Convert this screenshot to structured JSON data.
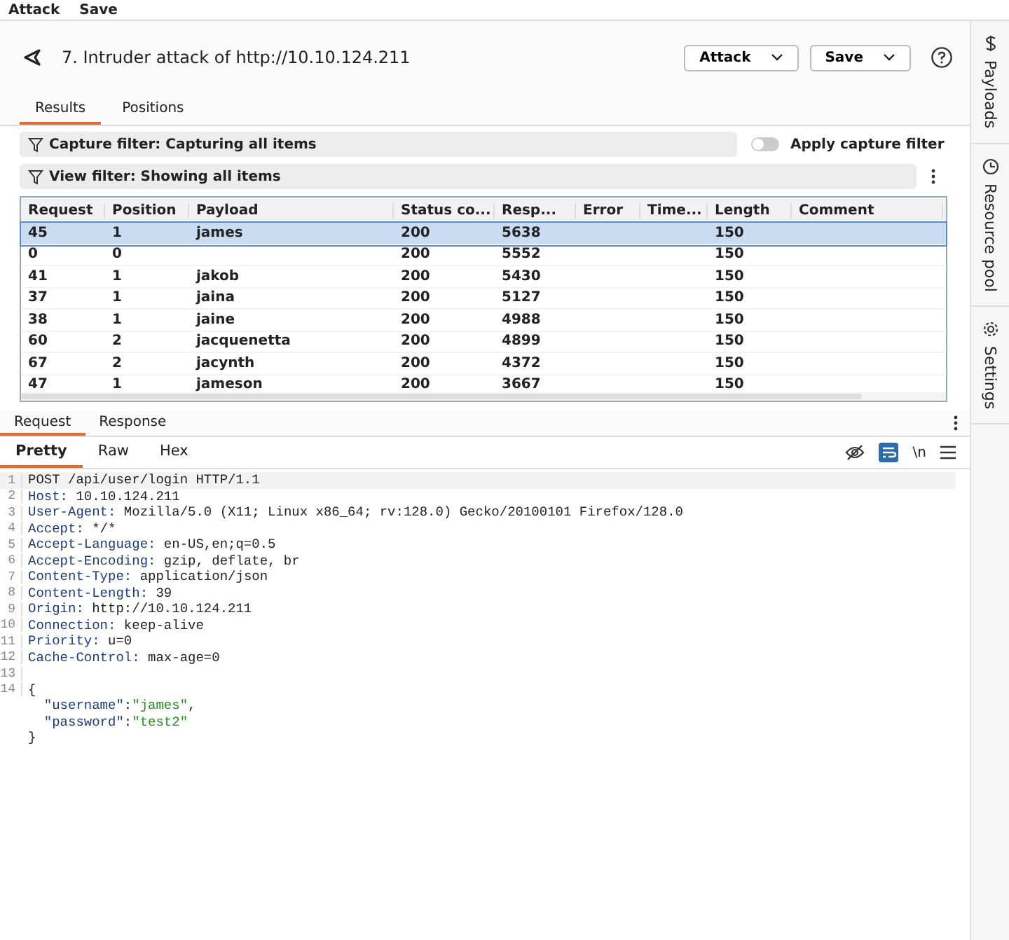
{
  "menu": [
    "Attack",
    "Save"
  ],
  "header": {
    "title": "7. Intruder attack of http://10.10.124.211",
    "buttons": [
      "Attack",
      "Save"
    ]
  },
  "tabs": [
    {
      "label": "Results",
      "selected": true
    },
    {
      "label": "Positions",
      "selected": false
    }
  ],
  "capture_filter": {
    "label": "Capture filter: Capturing all items",
    "toggle_label": "Apply capture filter",
    "on": false
  },
  "view_filter": {
    "label": "View filter: Showing all items"
  },
  "table": {
    "columns": [
      "Request",
      "Position",
      "Payload",
      "Status co...",
      "Resp...",
      "Error",
      "Time...",
      "Length",
      "Comment"
    ],
    "rows": [
      {
        "cells": [
          "45",
          "1",
          "james",
          "200",
          "5638",
          "",
          "",
          "150",
          ""
        ],
        "selected": true
      },
      {
        "cells": [
          "0",
          "0",
          "",
          "200",
          "5552",
          "",
          "",
          "150",
          ""
        ],
        "selected": false
      },
      {
        "cells": [
          "41",
          "1",
          "jakob",
          "200",
          "5430",
          "",
          "",
          "150",
          ""
        ],
        "selected": false
      },
      {
        "cells": [
          "37",
          "1",
          "jaina",
          "200",
          "5127",
          "",
          "",
          "150",
          ""
        ],
        "selected": false
      },
      {
        "cells": [
          "38",
          "1",
          "jaine",
          "200",
          "4988",
          "",
          "",
          "150",
          ""
        ],
        "selected": false
      },
      {
        "cells": [
          "60",
          "2",
          "jacquenetta",
          "200",
          "4899",
          "",
          "",
          "150",
          ""
        ],
        "selected": false
      },
      {
        "cells": [
          "67",
          "2",
          "jacynth",
          "200",
          "4372",
          "",
          "",
          "150",
          ""
        ],
        "selected": false
      },
      {
        "cells": [
          "47",
          "1",
          "jameson",
          "200",
          "3667",
          "",
          "",
          "150",
          ""
        ],
        "selected": false
      }
    ]
  },
  "message_tabs": [
    {
      "label": "Request",
      "selected": true
    },
    {
      "label": "Response",
      "selected": false
    }
  ],
  "view_tabs": [
    {
      "label": "Pretty",
      "selected": true
    },
    {
      "label": "Raw",
      "selected": false
    },
    {
      "label": "Hex",
      "selected": false
    }
  ],
  "newline_button": "\\n",
  "code": [
    {
      "number": "1",
      "parts": [
        {
          "kind": "plain",
          "text": "POST /api/user/login HTTP/1.1"
        }
      ]
    },
    {
      "number": "2",
      "parts": [
        {
          "kind": "key",
          "text": "Host: "
        },
        {
          "kind": "plain",
          "text": "10.10.124.211"
        }
      ]
    },
    {
      "number": "3",
      "parts": [
        {
          "kind": "key",
          "text": "User-Agent: "
        },
        {
          "kind": "plain",
          "text": "Mozilla/5.0 (X11; Linux x86_64; rv:128.0) Gecko/20100101 Firefox/128.0"
        }
      ]
    },
    {
      "number": "4",
      "parts": [
        {
          "kind": "key",
          "text": "Accept: "
        },
        {
          "kind": "plain",
          "text": "*/*"
        }
      ]
    },
    {
      "number": "5",
      "parts": [
        {
          "kind": "key",
          "text": "Accept-Language: "
        },
        {
          "kind": "plain",
          "text": "en-US,en;q=0.5"
        }
      ]
    },
    {
      "number": "6",
      "parts": [
        {
          "kind": "key",
          "text": "Accept-Encoding: "
        },
        {
          "kind": "plain",
          "text": "gzip, deflate, br"
        }
      ]
    },
    {
      "number": "7",
      "parts": [
        {
          "kind": "key",
          "text": "Content-Type: "
        },
        {
          "kind": "plain",
          "text": "application/json"
        }
      ]
    },
    {
      "number": "8",
      "parts": [
        {
          "kind": "key",
          "text": "Content-Length: "
        },
        {
          "kind": "plain",
          "text": "39"
        }
      ]
    },
    {
      "number": "9",
      "parts": [
        {
          "kind": "key",
          "text": "Origin: "
        },
        {
          "kind": "plain",
          "text": "http://10.10.124.211"
        }
      ]
    },
    {
      "number": "10",
      "parts": [
        {
          "kind": "key",
          "text": "Connection: "
        },
        {
          "kind": "plain",
          "text": "keep-alive"
        }
      ]
    },
    {
      "number": "11",
      "parts": [
        {
          "kind": "key",
          "text": "Priority: "
        },
        {
          "kind": "plain",
          "text": "u=0"
        }
      ]
    },
    {
      "number": "12",
      "parts": [
        {
          "kind": "key",
          "text": "Cache-Control: "
        },
        {
          "kind": "plain",
          "text": "max-age=0"
        }
      ]
    },
    {
      "number": "13"
    },
    {
      "number": "14",
      "parts": [
        {
          "kind": "plain",
          "text": "{"
        }
      ]
    },
    {
      "parts": [
        {
          "kind": "key",
          "text": "  \"username\""
        },
        {
          "kind": "plain",
          "text": ":"
        },
        {
          "kind": "string",
          "text": "\"james\""
        },
        {
          "kind": "plain",
          "text": ","
        }
      ]
    },
    {
      "parts": [
        {
          "kind": "key",
          "text": "  \"password\""
        },
        {
          "kind": "plain",
          "text": ":"
        },
        {
          "kind": "string",
          "text": "\"test2\""
        }
      ]
    },
    {
      "parts": [
        {
          "kind": "plain",
          "text": "}"
        }
      ]
    }
  ],
  "side_tabs": [
    {
      "label": "Payloads"
    },
    {
      "label": "Resource pool"
    },
    {
      "label": "Settings"
    }
  ]
}
